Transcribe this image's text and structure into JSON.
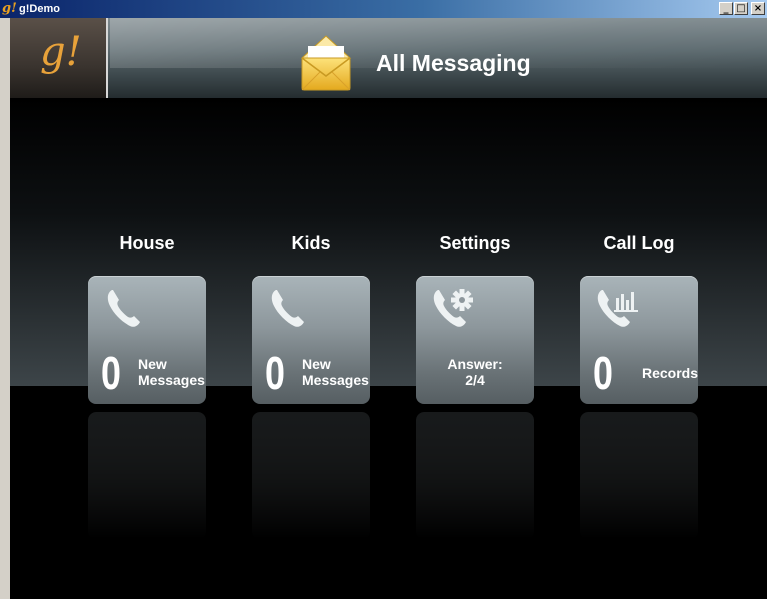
{
  "window": {
    "title": "g!Demo",
    "controls": {
      "minimize": "_",
      "maximize": "□",
      "close": "×"
    }
  },
  "header": {
    "logo": "g!",
    "title": "All Messaging",
    "icon": "envelope-icon"
  },
  "tiles": [
    {
      "label": "House",
      "count": "0",
      "line1": "New",
      "line2": "Messages",
      "icon": "phone-icon"
    },
    {
      "label": "Kids",
      "count": "0",
      "line1": "New",
      "line2": "Messages",
      "icon": "phone-icon"
    },
    {
      "label": "Settings",
      "line1": "Answer:",
      "line2": "2/4",
      "icon": "phone-gear-icon"
    },
    {
      "label": "Call Log",
      "count": "0",
      "line1": "Records",
      "icon": "phone-bars-icon"
    }
  ],
  "colors": {
    "logo": "#e8a23a",
    "tile_top": "#a9b4b9",
    "tile_bottom": "#565e62",
    "envelope": "#f5c842"
  }
}
